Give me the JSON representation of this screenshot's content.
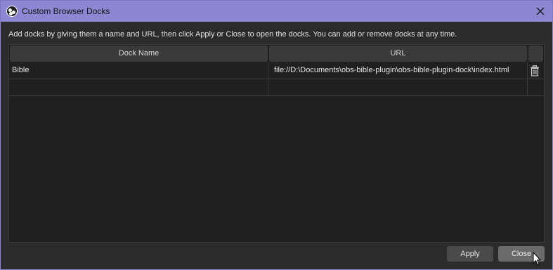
{
  "window": {
    "title": "Custom Browser Docks",
    "close_icon": "close-icon",
    "logo_icon": "obs-logo-icon"
  },
  "instruction": "Add docks by giving them a name and URL, then click Apply or Close to open the docks. You can add or remove docks at any time.",
  "table": {
    "headers": [
      "Dock Name",
      "URL"
    ],
    "rows": [
      {
        "name": "Bible",
        "url": "file://D:\\Documents\\obs-bible-plugin\\obs-bible-plugin-dock\\index.html",
        "action_icon": "trash-icon"
      },
      {
        "name": "",
        "url": ""
      }
    ]
  },
  "buttons": {
    "apply": "Apply",
    "close": "Close"
  },
  "colors": {
    "titlebar": "#8c87d2",
    "background": "#2b2b2b",
    "table": "#202020",
    "header": "#3a3a3a"
  }
}
